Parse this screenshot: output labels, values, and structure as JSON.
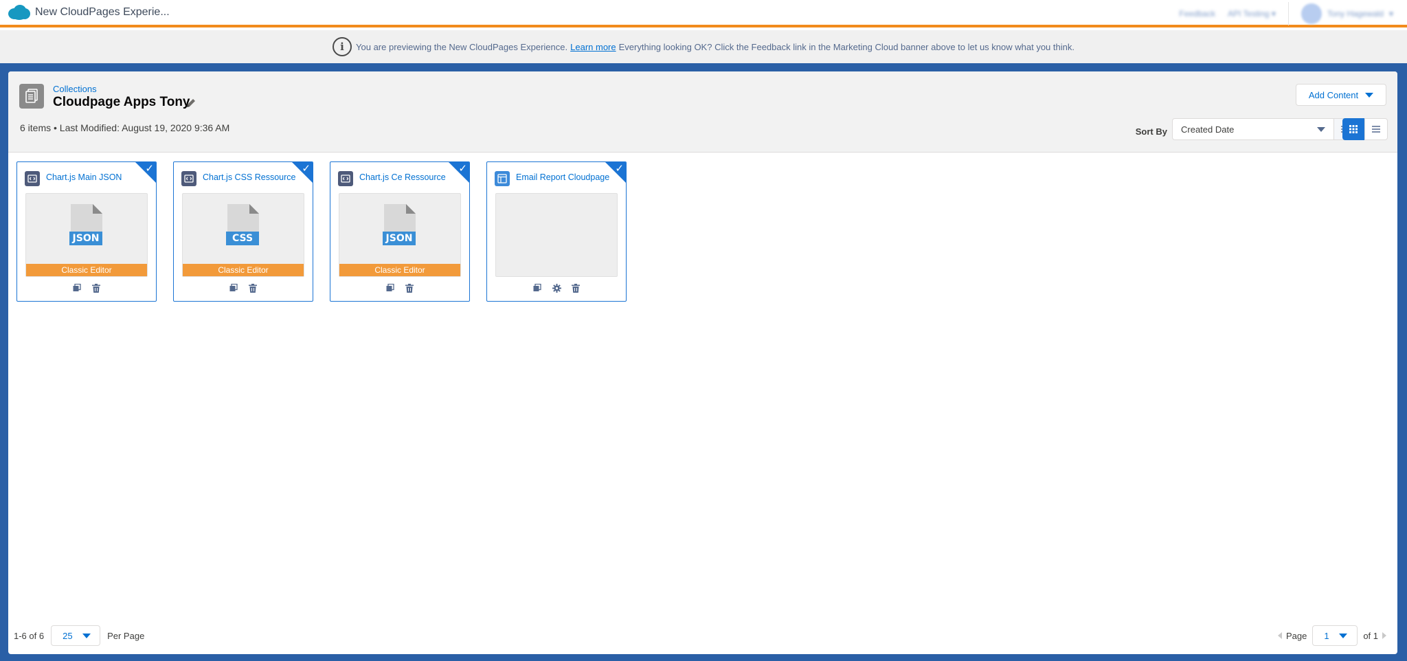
{
  "app": {
    "title": "New CloudPages Experie...",
    "top_links": [
      "Feedback",
      "API Testing"
    ],
    "user_name": "Tony Hagewald"
  },
  "banner": {
    "prefix": "You are previewing the New CloudPages Experience.",
    "link": "Learn more",
    "suffix": "Everything looking OK? Click the Feedback link in the Marketing Cloud banner above to let us know what you think."
  },
  "header": {
    "breadcrumb": "Collections",
    "title": "Cloudpage Apps Tony",
    "meta": "6 items • Last Modified: August 19, 2020 9:36 AM",
    "add_content": "Add Content",
    "sort_label": "Sort By",
    "sort_value": "Created Date"
  },
  "cards": [
    {
      "title": "Chart.js Main JSON",
      "icon": "code-resource-icon",
      "file_label": "JSON",
      "editor": "Classic Editor",
      "actions": [
        "copy-icon",
        "delete-icon"
      ]
    },
    {
      "title": "Chart.js CSS Ressource",
      "icon": "code-resource-icon",
      "file_label": "CSS",
      "editor": "Classic Editor",
      "actions": [
        "copy-icon",
        "delete-icon"
      ]
    },
    {
      "title": "Chart.js Ce Ressource",
      "icon": "code-resource-icon",
      "file_label": "JSON",
      "editor": "Classic Editor",
      "actions": [
        "copy-icon",
        "delete-icon"
      ]
    },
    {
      "title": "Email Report Cloudpage",
      "icon": "landing-page-icon",
      "file_label": "",
      "editor": "",
      "actions": [
        "copy-icon",
        "settings-icon",
        "delete-icon"
      ]
    }
  ],
  "footer": {
    "range": "1-6 of 6",
    "per_page_value": "25",
    "per_page_label": "Per Page",
    "page_label": "Page",
    "page_value": "1",
    "page_total": "of 1"
  },
  "colors": {
    "accent": "#1b74d4",
    "brand_orange": "#f28b1c",
    "editor_bar": "#f29a3a",
    "link": "#0070d2"
  }
}
